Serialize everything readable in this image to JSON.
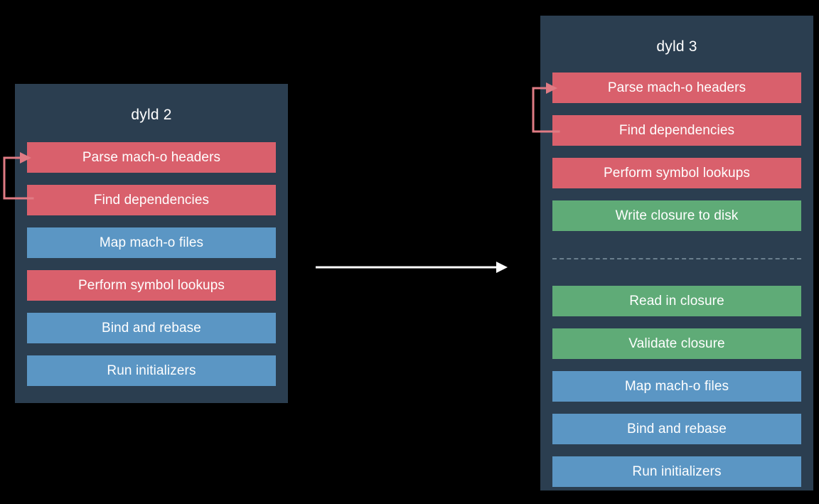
{
  "diagram": {
    "title_hidden": "",
    "background_color": "#000000",
    "panel_color": "#2b3e50",
    "colors": {
      "red": "#d9606c",
      "blue": "#5b96c4",
      "green": "#5fab77",
      "arrow_loop": "#e07b84",
      "arrow_transition": "#ffffff",
      "divider": "#6b7f8e",
      "text": "#ffffff"
    }
  },
  "left_panel": {
    "title": "dyld 2",
    "steps": [
      {
        "label": "Parse mach-o headers",
        "color": "red"
      },
      {
        "label": "Find dependencies",
        "color": "red"
      },
      {
        "label": "Map mach-o files",
        "color": "blue"
      },
      {
        "label": "Perform symbol lookups",
        "color": "red"
      },
      {
        "label": "Bind and rebase",
        "color": "blue"
      },
      {
        "label": "Run initializers",
        "color": "blue"
      }
    ],
    "loop_arrow": {
      "name": "loop-back-arrow",
      "from_step": "Find dependencies",
      "to_step": "Parse mach-o headers"
    }
  },
  "right_panel": {
    "title": "dyld 3",
    "steps_build": [
      {
        "label": "Parse mach-o headers",
        "color": "red"
      },
      {
        "label": "Find dependencies",
        "color": "red"
      },
      {
        "label": "Perform symbol lookups",
        "color": "red"
      },
      {
        "label": "Write closure to disk",
        "color": "green"
      }
    ],
    "separator": "dashed",
    "steps_launch": [
      {
        "label": "Read in closure",
        "color": "green"
      },
      {
        "label": "Validate closure",
        "color": "green"
      },
      {
        "label": "Map mach-o files",
        "color": "blue"
      },
      {
        "label": "Bind and rebase",
        "color": "blue"
      },
      {
        "label": "Run initializers",
        "color": "blue"
      }
    ],
    "loop_arrow": {
      "name": "loop-back-arrow",
      "from_step": "Find dependencies",
      "to_step": "Parse mach-o headers"
    }
  },
  "transition": {
    "name": "transition-arrow",
    "direction": "left-to-right",
    "label": ""
  }
}
